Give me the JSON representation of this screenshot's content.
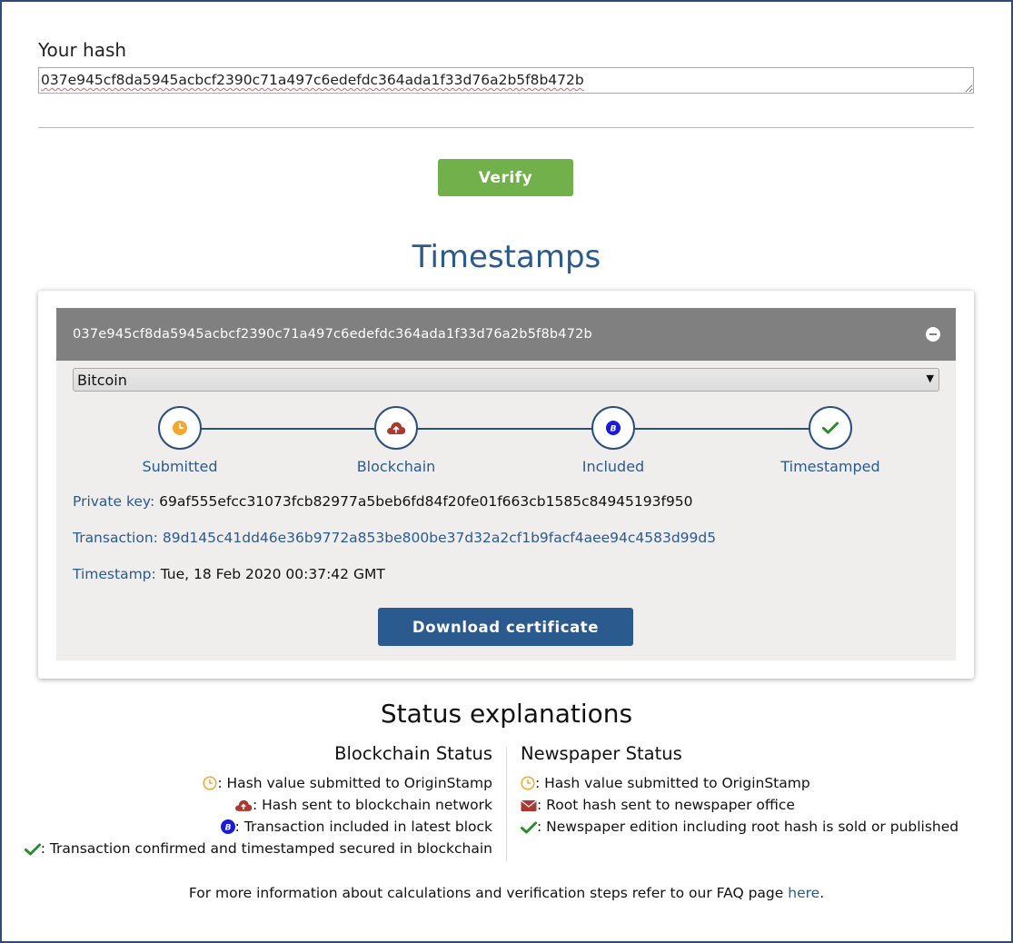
{
  "hash_section": {
    "label": "Your hash",
    "value": "037e945cf8da5945acbcf2390c71a497c6edefdc364ada1f33d76a2b5f8b472b"
  },
  "verify_label": "Verify",
  "timestamps_heading": "Timestamps",
  "card": {
    "hash": "037e945cf8da5945acbcf2390c71a497c6edefdc364ada1f33d76a2b5f8b472b",
    "selected_chain": "Bitcoin",
    "steps": [
      {
        "label": "Submitted",
        "icon": "clock-icon"
      },
      {
        "label": "Blockchain",
        "icon": "cloud-upload-icon"
      },
      {
        "label": "Included",
        "icon": "bitcoin-icon"
      },
      {
        "label": "Timestamped",
        "icon": "check-icon"
      }
    ],
    "private_key_label": "Private key:",
    "private_key": "69af555efcc31073fcb82977a5beb6fd84f20fe01f663cb1585c84945193f950",
    "transaction_label": "Transaction:",
    "transaction": "89d145c41dd46e36b9772a853be800be37d32a2cf1b9facf4aee94c4583d99d5",
    "timestamp_label": "Timestamp:",
    "timestamp": "Tue, 18 Feb 2020 00:37:42 GMT",
    "download_label": "Download certificate"
  },
  "status_explanations": {
    "heading": "Status explanations",
    "blockchain": {
      "title": "Blockchain Status",
      "items": [
        {
          "icon": "clock-icon",
          "text": ": Hash value submitted to OriginStamp"
        },
        {
          "icon": "cloud-upload-icon",
          "text": ": Hash sent to blockchain network"
        },
        {
          "icon": "bitcoin-icon",
          "text": ": Transaction included in latest block"
        },
        {
          "icon": "check-icon",
          "text": ": Transaction confirmed and timestamped secured in blockchain"
        }
      ]
    },
    "newspaper": {
      "title": "Newspaper Status",
      "items": [
        {
          "icon": "clock-icon",
          "text": ": Hash value submitted to OriginStamp"
        },
        {
          "icon": "envelope-icon",
          "text": ": Root hash sent to newspaper office"
        },
        {
          "icon": "check-icon",
          "text": ": Newspaper edition including root hash is sold or published"
        }
      ]
    }
  },
  "footer": {
    "text": "For more information about calculations and verification steps refer to our FAQ page ",
    "link": "here",
    "suffix": "."
  },
  "colors": {
    "clock": "#f0a830",
    "cloud": "#a83a32",
    "bitcoin": "#1a1adf",
    "check": "#2e8a2e",
    "accent": "#2b5a8e",
    "verify": "#71b04a"
  }
}
